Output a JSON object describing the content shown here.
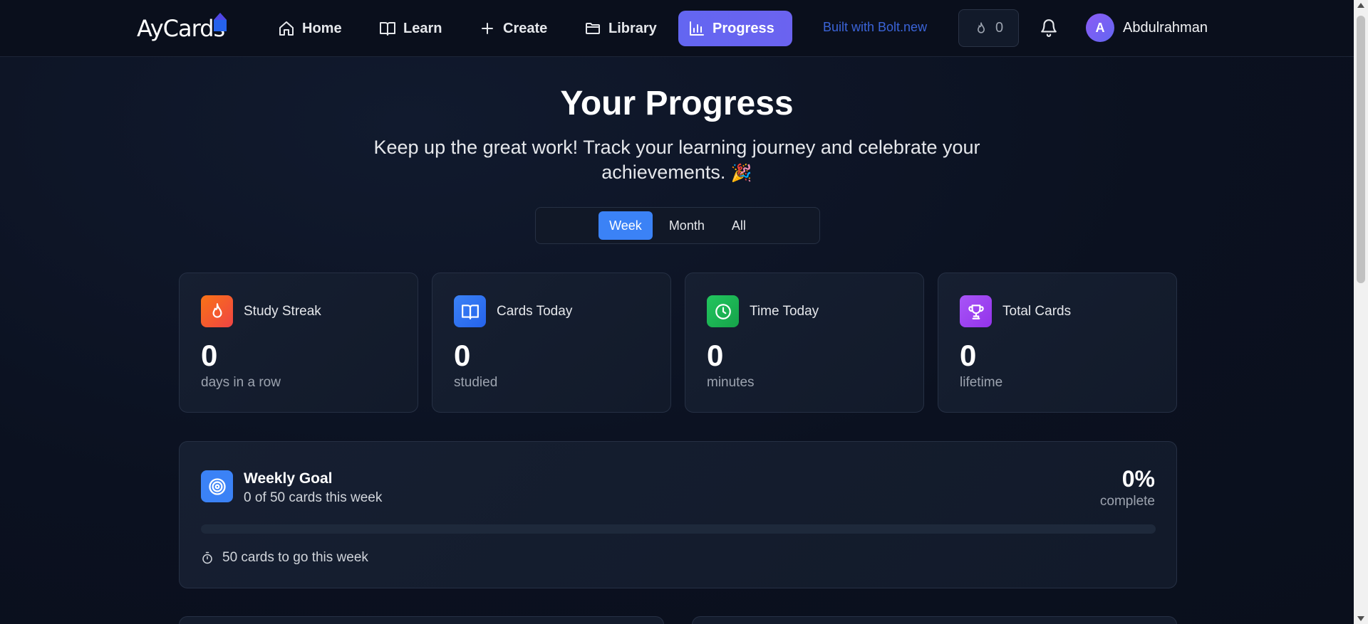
{
  "header": {
    "logo_text": "AyCards",
    "nav": [
      {
        "label": "Home",
        "icon": "home-icon"
      },
      {
        "label": "Learn",
        "icon": "book-open-icon"
      },
      {
        "label": "Create",
        "icon": "plus-icon"
      },
      {
        "label": "Library",
        "icon": "folder-icon"
      },
      {
        "label": "Progress",
        "icon": "bar-chart-icon",
        "active": true
      }
    ],
    "bolt_link": "Built with Bolt.new",
    "streak_count": "0",
    "user": {
      "initial": "A",
      "name": "Abdulrahman"
    }
  },
  "main": {
    "title": "Your Progress",
    "subtitle": "Keep up the great work! Track your learning journey and celebrate your achievements.",
    "subtitle_emoji": "🎉",
    "period_tabs": [
      {
        "label": "Week",
        "active": true
      },
      {
        "label": "Month"
      },
      {
        "label": "All"
      }
    ],
    "stats": [
      {
        "label": "Study Streak",
        "value": "0",
        "sub": "days in a row",
        "icon": "flame-icon",
        "color": "#f97316"
      },
      {
        "label": "Cards Today",
        "value": "0",
        "sub": "studied",
        "icon": "book-open-icon",
        "color": "#3b82f6"
      },
      {
        "label": "Time Today",
        "value": "0",
        "sub": "minutes",
        "icon": "clock-icon",
        "color": "#22c55e"
      },
      {
        "label": "Total Cards",
        "value": "0",
        "sub": "lifetime",
        "icon": "trophy-icon",
        "color": "#a855f7"
      }
    ],
    "weekly_goal": {
      "title": "Weekly Goal",
      "description": "0 of 50 cards this week",
      "percent": "0%",
      "complete_label": "complete",
      "progress": 0,
      "footer": "50 cards to go this week"
    }
  },
  "colors": {
    "accent": "#6366f1",
    "primary_blue": "#3b82f6",
    "background": "#0b1120"
  }
}
